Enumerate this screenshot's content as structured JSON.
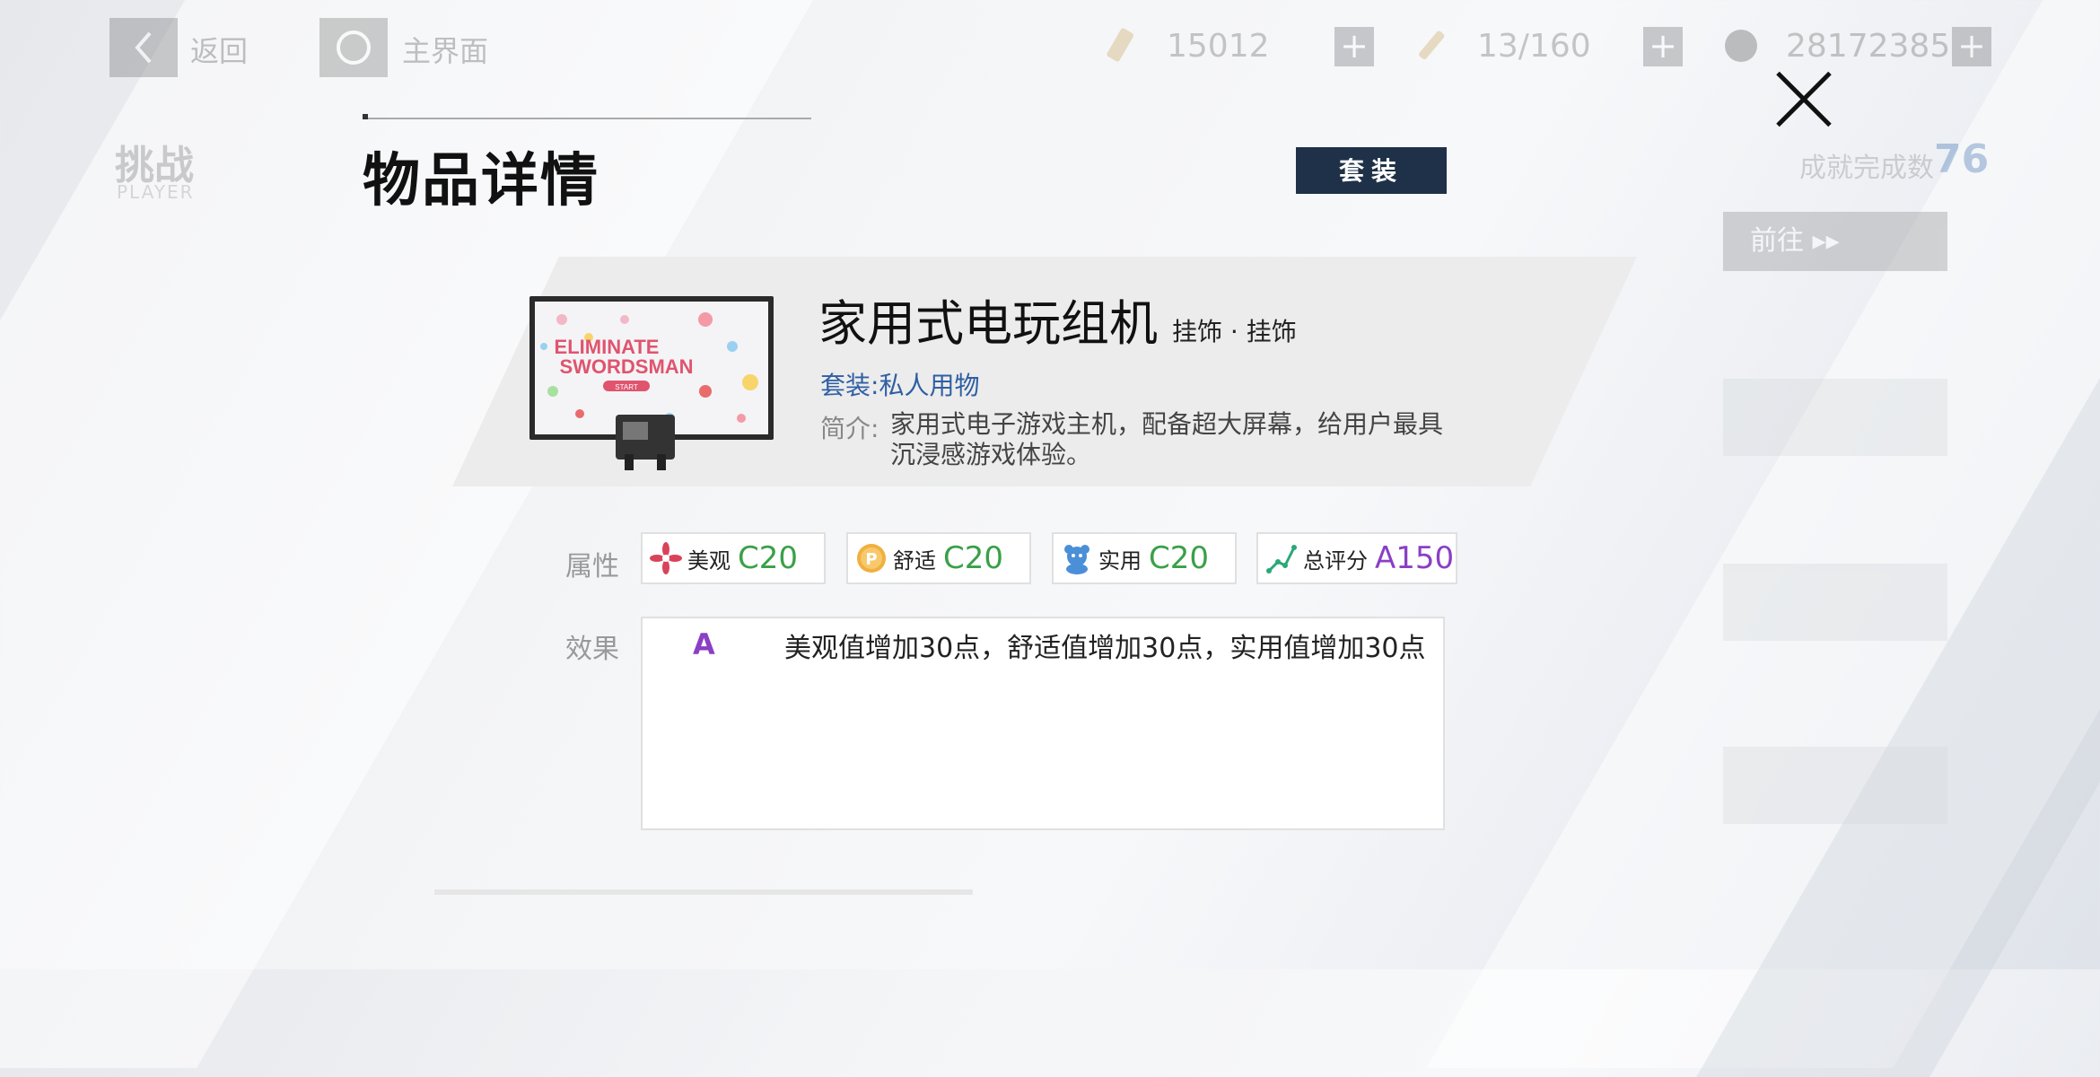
{
  "colors": {
    "accent_dark": "#1f3148",
    "set_blue": "#2f5fa3",
    "grade_green": "#3aa048",
    "grade_purple": "#8b3fc4"
  },
  "topbar": {
    "back_label": "返回",
    "home_label": "主界面",
    "resources": [
      {
        "icon": "ticket-icon",
        "value": "15012"
      },
      {
        "icon": "stamina-icon",
        "value": "13/160"
      },
      {
        "icon": "coin-icon",
        "value": "28172385"
      }
    ]
  },
  "background": {
    "title": "挑战",
    "subtitle": "PLAYER",
    "achievement_label": "成就完成数",
    "achievement_count": "76",
    "go_button": "前往 ▸▸"
  },
  "modal": {
    "title": "物品详情",
    "set_button": "套装",
    "item": {
      "name": "家用式电玩组机",
      "category": "挂饰 · 挂饰",
      "set_label": "套装:",
      "set_name": "私人用物",
      "desc_label": "简介:",
      "description": "家用式电子游戏主机，配备超大屏幕，给用户最具沉浸感游戏体验。",
      "image_text": [
        "ELIMINATE",
        "SWORDSMAN",
        "START"
      ]
    },
    "attributes_label": "属性",
    "attributes": [
      {
        "icon": "flower-icon",
        "name": "美观",
        "value": "C20",
        "color": "#3aa048"
      },
      {
        "icon": "coin-p-icon",
        "name": "舒适",
        "value": "C20",
        "color": "#3aa048"
      },
      {
        "icon": "bear-icon",
        "name": "实用",
        "value": "C20",
        "color": "#3aa048"
      },
      {
        "icon": "graph-icon",
        "name": "总评分",
        "value": "A150",
        "color": "#8b3fc4"
      }
    ],
    "effect_label": "效果",
    "effect": {
      "grade": "A",
      "text": "美观值增加30点，舒适值增加30点，实用值增加30点"
    }
  }
}
